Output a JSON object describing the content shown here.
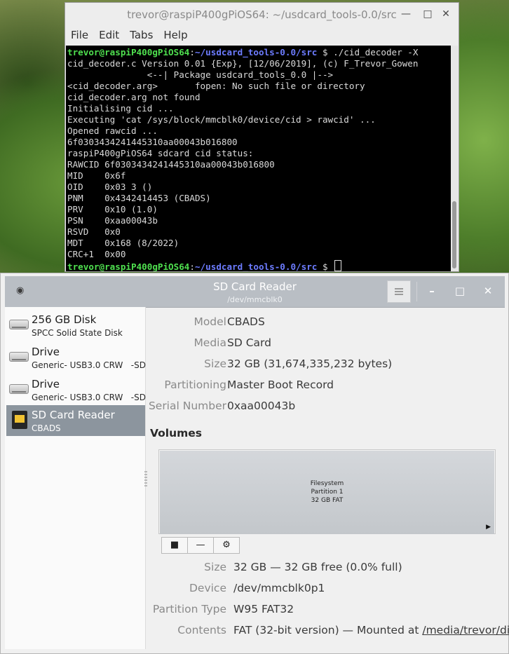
{
  "terminal": {
    "title": "trevor@raspiP400gPiOS64: ~/usdcard_tools-0.0/src",
    "menu": [
      "File",
      "Edit",
      "Tabs",
      "Help"
    ],
    "prompt_user": "trevor@raspiP400gPiOS64",
    "prompt_path": "~/usdcard_tools-0.0/src",
    "prompt_suffix": " $ ",
    "command": "./cid_decoder -X",
    "output": [
      "cid_decoder.c Version 0.01 {Exp}, [12/06/2019], (c) F_Trevor_Gowen",
      "               <--| Package usdcard_tools_0.0 |-->",
      "<cid_decoder.arg>       fopen: No such file or directory",
      "cid_decoder.arg not found",
      "Initialising cid ...",
      "Executing 'cat /sys/block/mmcblk0/device/cid > rawcid' ...",
      "Opened rawcid ...",
      "6f0303434241445310aa00043b016800",
      "raspiP400gPiOS64 sdcard cid status:",
      "RAWCID 6f0303434241445310aa00043b016800",
      "MID    0x6f",
      "OID    0x03 3 ()",
      "PNM    0x4342414453 (CBADS)",
      "PRV    0x10 (1.0)",
      "PSN    0xaa00043b",
      "RSVD   0x0",
      "MDT    0x168 (8/2022)",
      "CRC+1  0x00"
    ]
  },
  "disks": {
    "title": "SD Card Reader",
    "subtitle": "/dev/mmcblk0",
    "drives": [
      {
        "name": "256 GB Disk",
        "sub": "SPCC Solid State Disk",
        "icon": "hard-disk-icon"
      },
      {
        "name": "Drive",
        "sub": "Generic- USB3.0 CRW   -SD",
        "icon": "hard-disk-icon"
      },
      {
        "name": "Drive",
        "sub": "Generic- USB3.0 CRW   -SD",
        "icon": "hard-disk-icon"
      },
      {
        "name": "SD Card Reader",
        "sub": "CBADS",
        "icon": "sd-card-icon"
      }
    ],
    "props": {
      "model_k": "Model",
      "model_v": "CBADS",
      "media_k": "Media",
      "media_v": "SD Card",
      "size_k": "Size",
      "size_v": "32 GB (31,674,335,232 bytes)",
      "part_k": "Partitioning",
      "part_v": "Master Boot Record",
      "serial_k": "Serial Number",
      "serial_v": "0xaa00043b"
    },
    "volumes_heading": "Volumes",
    "volume_block": {
      "line1": "Filesystem",
      "line2": "Partition 1",
      "line3": "32 GB FAT"
    },
    "volume_props": {
      "size_k": "Size",
      "size_v": "32 GB — 32 GB free (0.0% full)",
      "device_k": "Device",
      "device_v": "/dev/mmcblk0p1",
      "ptype_k": "Partition Type",
      "ptype_v": "W95 FAT32",
      "contents_k": "Contents",
      "contents_v": "FAT (32-bit version) — Mounted at ",
      "mount_link": "/media/trevor/disk"
    }
  }
}
